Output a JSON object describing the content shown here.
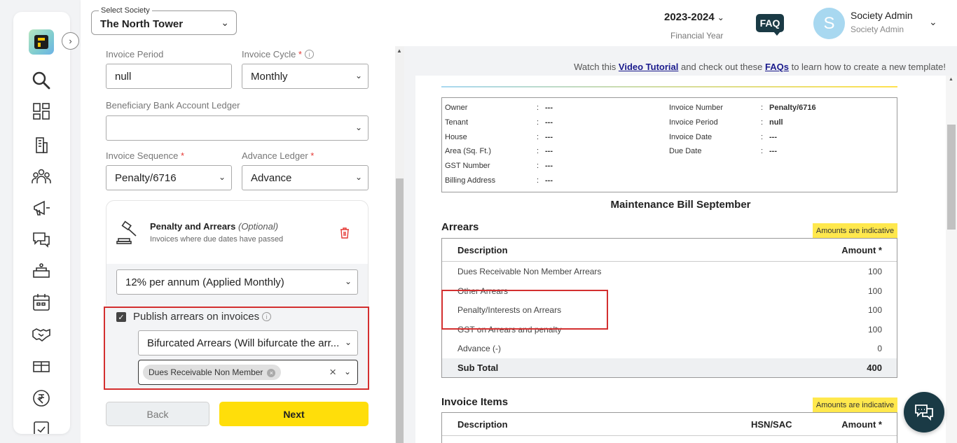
{
  "header": {
    "society_legend": "Select Society",
    "society_value": "The North Tower",
    "fy_value": "2023-2024",
    "fy_label": "Financial Year",
    "faq": "FAQ",
    "avatar_letter": "S",
    "user_name": "Society Admin",
    "user_role": "Society Admin"
  },
  "sidebar": {
    "items": [
      "search-icon",
      "dashboard-icon",
      "building-icon",
      "members-icon",
      "announcement-icon",
      "chat-icon",
      "amenities-icon",
      "calendar-icon",
      "handshake-icon",
      "gift-icon",
      "rupee-icon",
      "reports-icon"
    ]
  },
  "form": {
    "invoice_period_label": "Invoice Period",
    "invoice_period_value": "null",
    "invoice_cycle_label": "Invoice Cycle",
    "invoice_cycle_value": "Monthly",
    "bank_ledger_label": "Beneficiary Bank Account Ledger",
    "bank_ledger_value": "",
    "invoice_sequence_label": "Invoice Sequence",
    "invoice_sequence_value": "Penalty/6716",
    "advance_ledger_label": "Advance Ledger",
    "advance_ledger_value": "Advance",
    "penalty_title": "Penalty and Arrears",
    "penalty_optional": "(Optional)",
    "penalty_subtitle": "Invoices where due dates have passed",
    "penalty_rate_value": "12% per annum (Applied Monthly)",
    "publish_label": "Publish arrears on invoices",
    "publish_checked": true,
    "arrears_mode_value": "Bifurcated Arrears (Will bifurcate the arr...",
    "arrears_chip": "Dues Receivable Non Member",
    "back_label": "Back",
    "next_label": "Next"
  },
  "preview": {
    "tutorial_prefix": "Watch this",
    "tutorial_link": "Video Tutorial",
    "tutorial_middle": "and check out these",
    "faqs_link": "FAQs",
    "tutorial_suffix": "to learn how to create a new template!",
    "info_left": [
      {
        "k": "Owner",
        "v": "---"
      },
      {
        "k": "Tenant",
        "v": "---"
      },
      {
        "k": "House",
        "v": "---"
      },
      {
        "k": "Area (Sq. Ft.)",
        "v": "---"
      },
      {
        "k": "GST Number",
        "v": "---"
      },
      {
        "k": "Billing Address",
        "v": "---"
      }
    ],
    "info_right": [
      {
        "k": "Invoice Number",
        "v": "Penalty/6716"
      },
      {
        "k": "Invoice Period",
        "v": "null"
      },
      {
        "k": "Invoice Date",
        "v": "---"
      },
      {
        "k": "Due Date",
        "v": "---"
      }
    ],
    "bill_title": "Maintenance Bill September",
    "arrears_title": "Arrears",
    "indicative": "Amounts are indicative",
    "col_description": "Description",
    "col_amount": "Amount *",
    "col_hsn": "HSN/SAC",
    "arrears_rows": [
      {
        "d": "Dues Receivable Non Member Arrears",
        "a": "100"
      },
      {
        "d": "Other Arrears",
        "a": "100"
      },
      {
        "d": "Penalty/Interests on Arrears",
        "a": "100"
      },
      {
        "d": "GST on Arrears and penalty",
        "a": "100"
      },
      {
        "d": "Advance (-)",
        "a": "0"
      }
    ],
    "subtotal_label": "Sub Total",
    "subtotal_value": "400",
    "items_title": "Invoice Items"
  },
  "colors": {
    "accent_yellow": "#ffde0a",
    "navy": "#1a3a45",
    "highlight_red": "#d32f2f"
  }
}
